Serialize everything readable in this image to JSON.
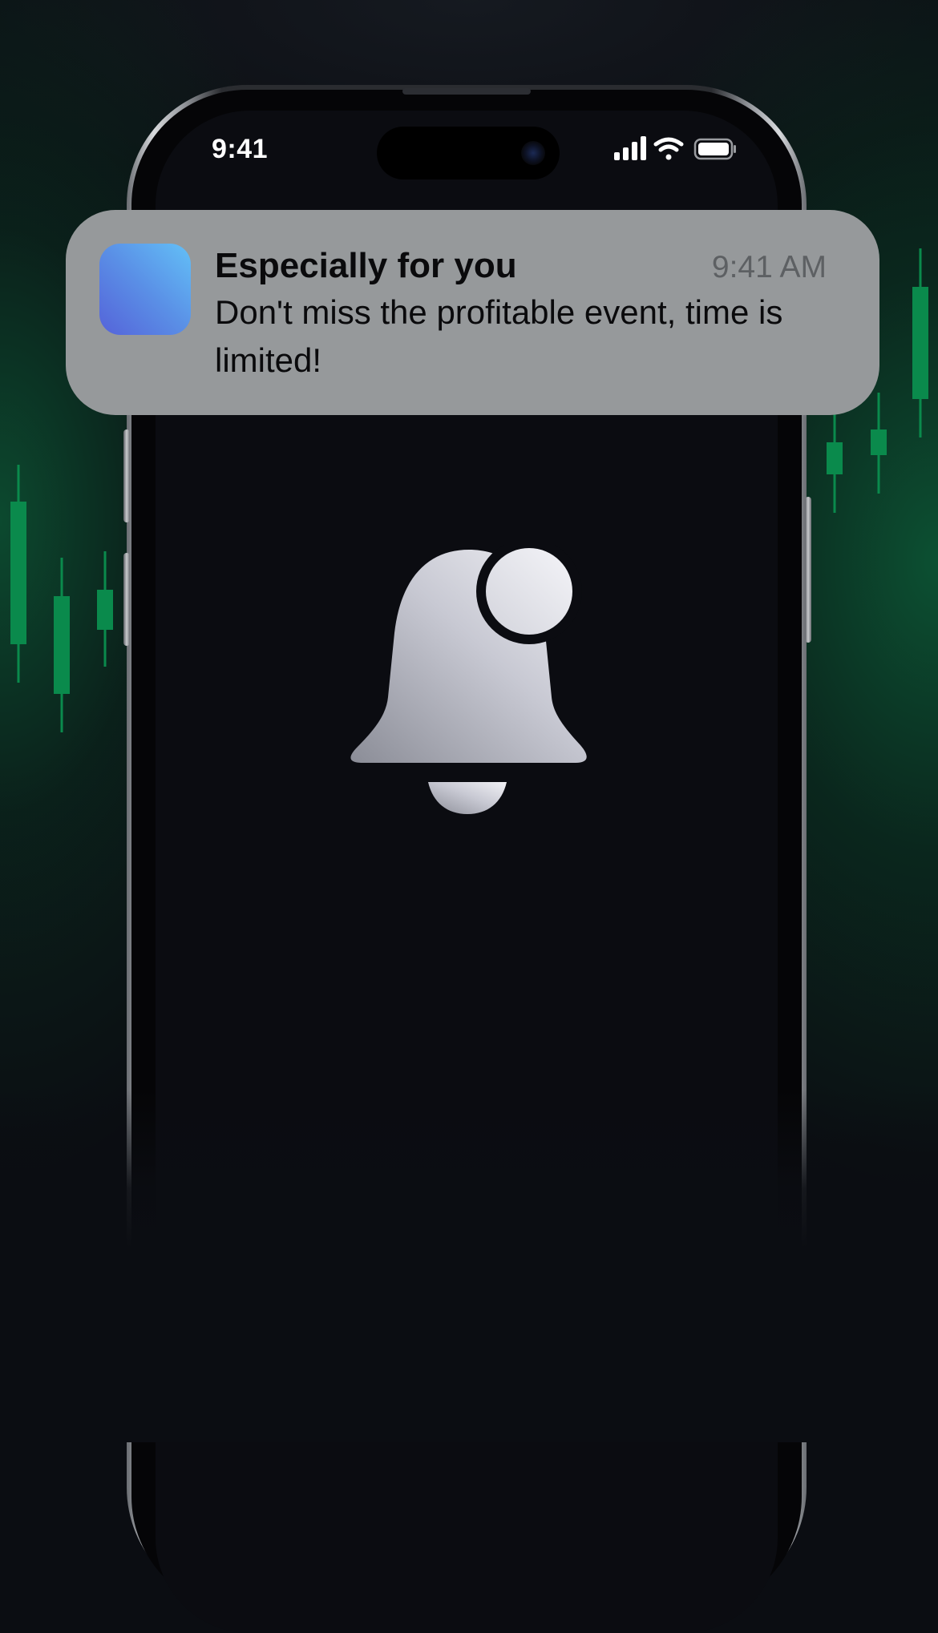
{
  "status_bar": {
    "time": "9:41",
    "icons": [
      "cellular-signal-icon",
      "wifi-icon",
      "battery-icon"
    ]
  },
  "notification": {
    "app_icon": "app-icon",
    "title": "Especially for you",
    "time": "9:41 AM",
    "message": "Don't miss the profitable event, time is limited!"
  },
  "center_icon": "bell-notification-icon",
  "decor": {
    "candlestick_icon": "candlestick-chart-icon"
  },
  "colors": {
    "background": "#0b0d12",
    "glow_green": "#0c5434",
    "candle_green": "#0a8a4c",
    "notification_bg": "#96999b",
    "app_icon_from": "#5563d9",
    "app_icon_to": "#63c0f7"
  }
}
